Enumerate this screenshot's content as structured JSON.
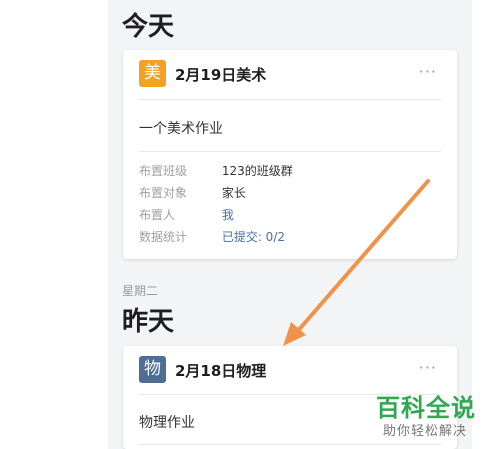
{
  "today": {
    "title": "今天",
    "card": {
      "icon_char": "美",
      "icon_color": "#f4a022",
      "title": "2月19日美术",
      "more": "···",
      "description": "一个美术作业",
      "details": [
        {
          "label": "布置班级",
          "value": "123的班级群"
        },
        {
          "label": "布置对象",
          "value": "家长"
        },
        {
          "label": "布置人",
          "value": "我"
        },
        {
          "label": "数据统计",
          "value": "已提交: 0/2"
        }
      ]
    }
  },
  "yesterday": {
    "weekday": "星期二",
    "title": "昨天",
    "card": {
      "icon_char": "物",
      "icon_color": "#4f6e95",
      "title": "2月18日物理",
      "more": "···",
      "description": "物理作业"
    }
  },
  "watermark": {
    "brand": "百科全说",
    "tagline": "助你轻松解决"
  },
  "annotation": {
    "arrow_color": "#f0924a"
  }
}
